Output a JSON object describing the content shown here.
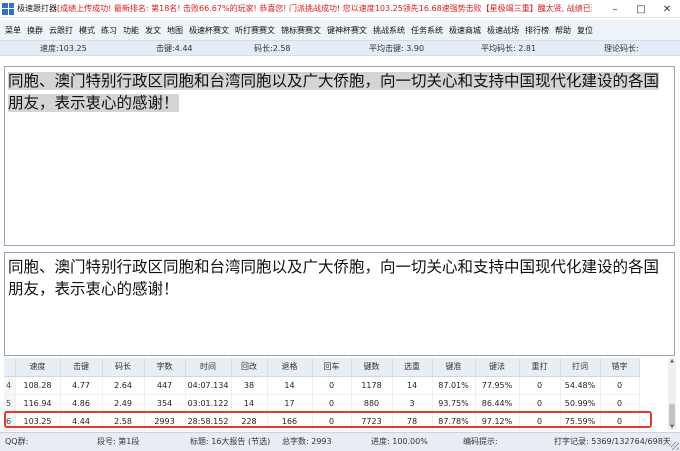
{
  "titlebar": {
    "app_name": "极速跟打器",
    "marquee": "[成绩上传成功!  最新排名: 第18名! 击败66.67%的玩家! 恭喜您! 门派挑战成功! 您以速度103.25领先16.68速强势击败【星极竭三重】醜太贤, 战绩已通知双方门",
    "minimize": "–",
    "maximize": "□",
    "close": "✕"
  },
  "menu": [
    "菜单",
    "换群",
    "云跟打",
    "模式",
    "练习",
    "功能",
    "发文",
    "地图",
    "极速杯赛文",
    "听打赛赛文",
    "锦标赛赛文",
    "键神杯赛文",
    "挑战系统",
    "任务系统",
    "极速商城",
    "极速战场",
    "排行榜",
    "帮助",
    "复位"
  ],
  "stats": {
    "speed": "速度:103.25",
    "keystroke": "击键:4.44",
    "code_length": "码长:2.58",
    "avg_keystroke": "平均击键: 3.90",
    "avg_code_length": "平均码长: 2.81",
    "theory_code_length": "理论码长:"
  },
  "source_text": "同胞、澳门特别行政区同胞和台湾同胞以及广大侨胞，向一切关心和支持中国现代化建设的各国朋友，表示衷心的感谢！",
  "typed_text": "同胞、澳门特别行政区同胞和台湾同胞以及广大侨胞，向一切关心和支持中国现代化建设的各国朋友，表示衷心的感谢！",
  "table": {
    "headers": [
      "",
      "速度",
      "击键",
      "码长",
      "字数",
      "时间",
      "回改",
      "退格",
      "回车",
      "键数",
      "选重",
      "键准",
      "键法",
      "重打",
      "打词",
      "错字"
    ],
    "rows": [
      [
        "4",
        "108.28",
        "4.77",
        "2.64",
        "447",
        "04:07.134",
        "38",
        "14",
        "0",
        "1178",
        "14",
        "87.01%",
        "77.95%",
        "0",
        "54.48%",
        "0"
      ],
      [
        "5",
        "116.94",
        "4.86",
        "2.49",
        "354",
        "03:01.122",
        "14",
        "17",
        "0",
        "880",
        "3",
        "93.75%",
        "86.44%",
        "0",
        "50.99%",
        "0"
      ],
      [
        "6",
        "103.25",
        "4.44",
        "2.58",
        "2993",
        "28:58.152",
        "228",
        "166",
        "0",
        "7723",
        "78",
        "87.78%",
        "97.12%",
        "0",
        "75.59%",
        "0"
      ]
    ]
  },
  "status": {
    "qq_group": "QQ群:",
    "segment": "段号: 第1段",
    "title": "标题: 16大报告 (节选)",
    "total_words": "总字数: 2993",
    "progress": "进度: 100.00%",
    "hint": "编码提示:",
    "record": "打字记录: 5369/132764/698天"
  }
}
